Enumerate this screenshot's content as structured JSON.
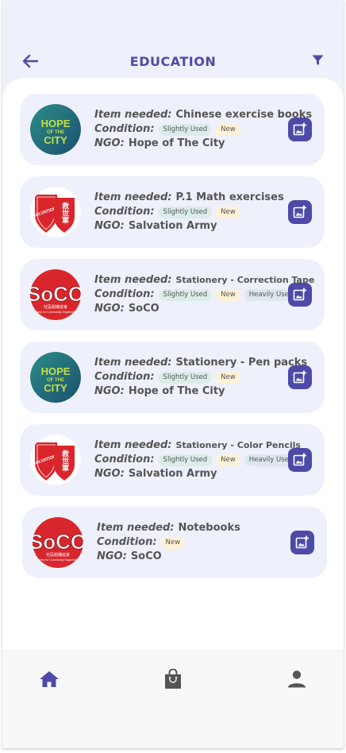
{
  "header": {
    "title": "EDUCATION",
    "back_icon": "arrow-back-icon",
    "filter_icon": "filter-icon"
  },
  "labels": {
    "item": "Item needed:",
    "condition": "Condition:",
    "ngo": "NGO:"
  },
  "colors": {
    "accent": "#4e4aa8",
    "card_bg": "#eef0fb",
    "tag_slightly_used": "#dcece9",
    "tag_new": "#fdf2d6",
    "tag_heavily_used": "#dde7ee"
  },
  "items": [
    {
      "item": "Chinese exercise books",
      "conditions": [
        "Slightly Used",
        "New"
      ],
      "ngo": "Hope of The City",
      "logo": "hope-of-the-city"
    },
    {
      "item": "P.1 Math exercises",
      "conditions": [
        "Slightly Used",
        "New"
      ],
      "ngo": "Salvation Army",
      "logo": "salvation-army"
    },
    {
      "item": "Stationery - Correction Tape",
      "conditions": [
        "Slightly Used",
        "New",
        "Heavily Used"
      ],
      "ngo": "SoCO",
      "logo": "soco"
    },
    {
      "item": "Stationery - Pen packs",
      "conditions": [
        "Slightly Used",
        "New"
      ],
      "ngo": "Hope of The City",
      "logo": "hope-of-the-city"
    },
    {
      "item": "Stationery - Color Pencils",
      "conditions": [
        "Slightly Used",
        "New",
        "Heavily Used"
      ],
      "ngo": "Salvation Army",
      "logo": "salvation-army"
    },
    {
      "item": "Notebooks",
      "conditions": [
        "New"
      ],
      "ngo": "SoCO",
      "logo": "soco"
    }
  ],
  "logo_text": {
    "hope": {
      "l1": "HOPE",
      "l2": "OF THE",
      "l3": "CITY"
    },
    "salvation": {
      "arc": "THE SALVATION ARMY",
      "chinese": "救世軍"
    },
    "soco": {
      "big": "SoCO",
      "chinese": "社區組織協會",
      "eng": "Society for Community Organization"
    }
  },
  "nav": [
    {
      "name": "home",
      "icon": "home-icon"
    },
    {
      "name": "bag",
      "icon": "shopping-bag-icon"
    },
    {
      "name": "profile",
      "icon": "person-icon"
    }
  ]
}
